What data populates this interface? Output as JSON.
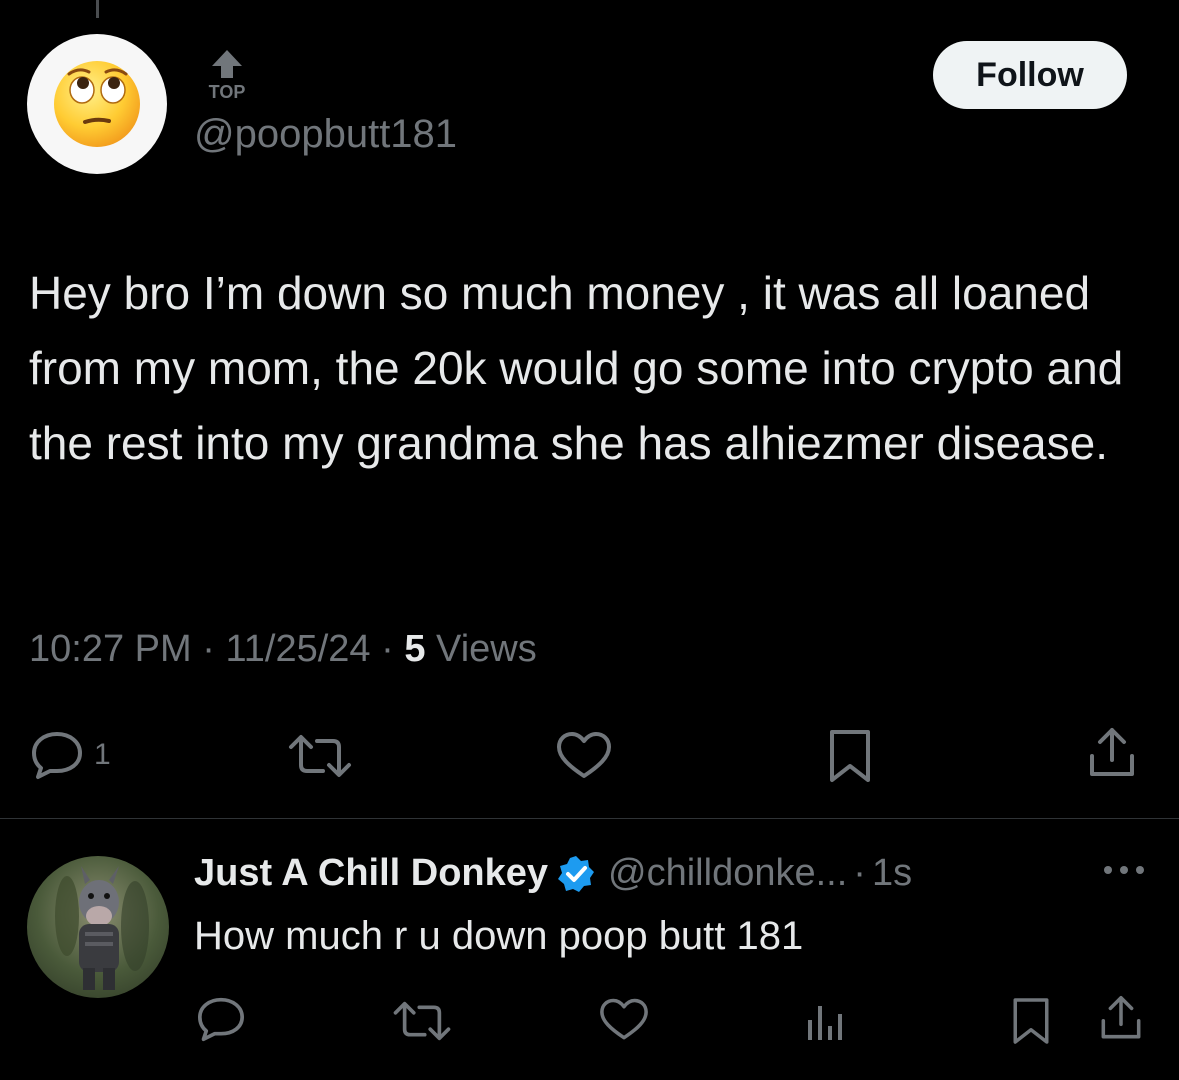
{
  "tweet": {
    "top_badge": "TOP",
    "handle": "@poopbutt181",
    "follow_label": "Follow",
    "text": "Hey bro I’m down so much money , it was all loaned from my mom, the 20k would go some into crypto and the rest into my grandma she has alhiezmer disease.",
    "time": "10:27 PM",
    "date": "11/25/24",
    "views_count": "5",
    "views_label": "Views",
    "reply_count": "1",
    "avatar_icon": "rolling-eyes-emoji"
  },
  "reply": {
    "name": "Just A Chill Donkey",
    "handle": "@chilldonke...",
    "time": "1s",
    "text": "How much r u down poop butt 181",
    "avatar_icon": "donkey-avatar"
  },
  "colors": {
    "background": "#000000",
    "text_primary": "#e7e9ea",
    "text_secondary": "#71767b",
    "verified_blue": "#1d9bf0",
    "follow_bg": "#eff3f4"
  }
}
